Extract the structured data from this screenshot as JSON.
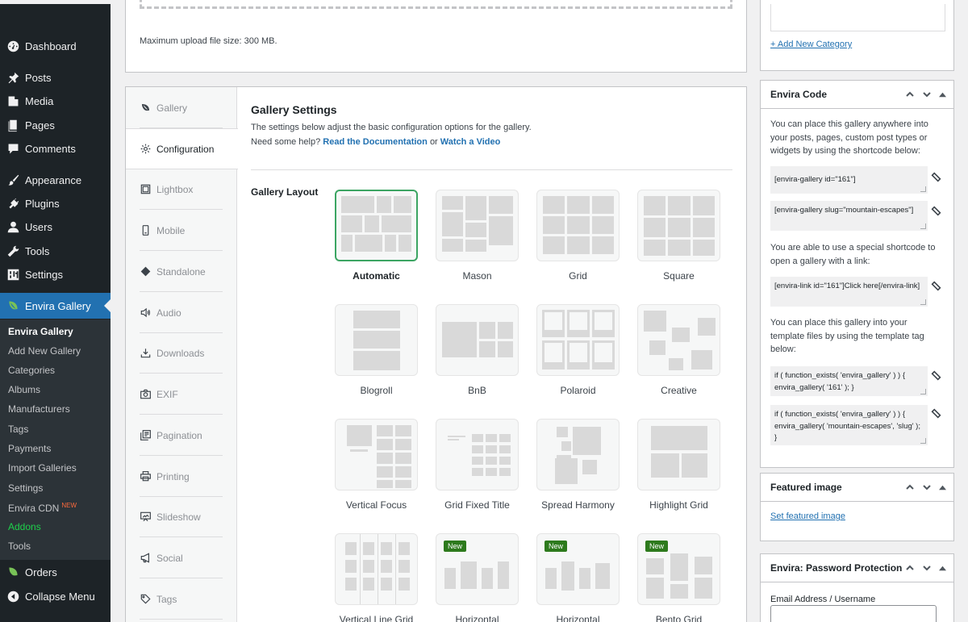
{
  "sidebar": {
    "items": [
      {
        "label": "Dashboard",
        "icon": "dashboard-icon"
      },
      {
        "label": "Posts",
        "icon": "pin-icon"
      },
      {
        "label": "Media",
        "icon": "media-icon"
      },
      {
        "label": "Pages",
        "icon": "pages-icon"
      },
      {
        "label": "Comments",
        "icon": "comment-icon"
      },
      {
        "label": "Appearance",
        "icon": "brush-icon"
      },
      {
        "label": "Plugins",
        "icon": "plug-icon"
      },
      {
        "label": "Users",
        "icon": "user-icon"
      },
      {
        "label": "Tools",
        "icon": "wrench-icon"
      },
      {
        "label": "Settings",
        "icon": "sliders-icon"
      },
      {
        "label": "Envira Gallery",
        "icon": "envira-leaf-icon"
      },
      {
        "label": "Orders",
        "icon": "envira-leaf-icon"
      },
      {
        "label": "Collapse Menu",
        "icon": "collapse-icon"
      }
    ],
    "submenu": [
      {
        "label": "Envira Gallery"
      },
      {
        "label": "Add New Gallery"
      },
      {
        "label": "Categories"
      },
      {
        "label": "Albums"
      },
      {
        "label": "Manufacturers"
      },
      {
        "label": "Tags"
      },
      {
        "label": "Payments"
      },
      {
        "label": "Import Galleries"
      },
      {
        "label": "Settings"
      },
      {
        "label": "Envira CDN",
        "badge": "NEW"
      },
      {
        "label": "Addons"
      },
      {
        "label": "Tools"
      }
    ]
  },
  "upload": {
    "max_size": "Maximum upload file size: 300 MB."
  },
  "tabs": [
    {
      "label": "Gallery",
      "icon": "envira-leaf-icon"
    },
    {
      "label": "Configuration",
      "icon": "gear-icon"
    },
    {
      "label": "Lightbox",
      "icon": "lightbox-icon"
    },
    {
      "label": "Mobile",
      "icon": "mobile-icon"
    },
    {
      "label": "Standalone",
      "icon": "diamond-icon"
    },
    {
      "label": "Audio",
      "icon": "speaker-icon"
    },
    {
      "label": "Downloads",
      "icon": "download-icon"
    },
    {
      "label": "EXIF",
      "icon": "camera-icon"
    },
    {
      "label": "Pagination",
      "icon": "pagination-icon"
    },
    {
      "label": "Printing",
      "icon": "printer-icon"
    },
    {
      "label": "Slideshow",
      "icon": "slideshow-icon"
    },
    {
      "label": "Social",
      "icon": "megaphone-icon"
    },
    {
      "label": "Tags",
      "icon": "tag-icon"
    }
  ],
  "panel": {
    "title": "Gallery Settings",
    "description": "The settings below adjust the basic configuration options for the gallery.",
    "help_prefix": "Need some help?",
    "help_docs": "Read the Documentation",
    "help_or": "or",
    "help_video": "Watch a Video",
    "layout_label": "Gallery Layout"
  },
  "layouts": [
    {
      "label": "Automatic",
      "selected": true
    },
    {
      "label": "Mason"
    },
    {
      "label": "Grid"
    },
    {
      "label": "Square"
    },
    {
      "label": "Blogroll"
    },
    {
      "label": "BnB"
    },
    {
      "label": "Polaroid"
    },
    {
      "label": "Creative"
    },
    {
      "label": "Vertical Focus"
    },
    {
      "label": "Grid Fixed Title"
    },
    {
      "label": "Spread Harmony"
    },
    {
      "label": "Highlight Grid"
    },
    {
      "label": "Vertical Line Grid"
    },
    {
      "label": "Horizontal",
      "badge": "New"
    },
    {
      "label": "Horizontal",
      "badge": "New"
    },
    {
      "label": "Bento Grid",
      "badge": "New"
    }
  ],
  "categories": {
    "add_new": "+ Add New Category"
  },
  "envira_code": {
    "title": "Envira Code",
    "intro": "You can place this gallery anywhere into your posts, pages, custom post types or widgets by using the shortcode below:",
    "code1": "[envira-gallery id=\"161\"]",
    "code2": "[envira-gallery slug=\"mountain-escapes\"]",
    "link_text": "You are able to use a special shortcode to open a gallery with a link:",
    "code3": "[envira-link id=\"161\"]Click here[/envira-link]",
    "template_text": "You can place this gallery into your template files by using the template tag below:",
    "code4": "if ( function_exists( 'envira_gallery' ) ) { envira_gallery( '161' ); }",
    "code5": "if ( function_exists( 'envira_gallery' ) ) { envira_gallery( 'mountain-escapes', 'slug' ); }"
  },
  "featured_image": {
    "title": "Featured image",
    "link": "Set featured image"
  },
  "password": {
    "title": "Envira: Password Protection",
    "email_label": "Email Address / Username"
  }
}
